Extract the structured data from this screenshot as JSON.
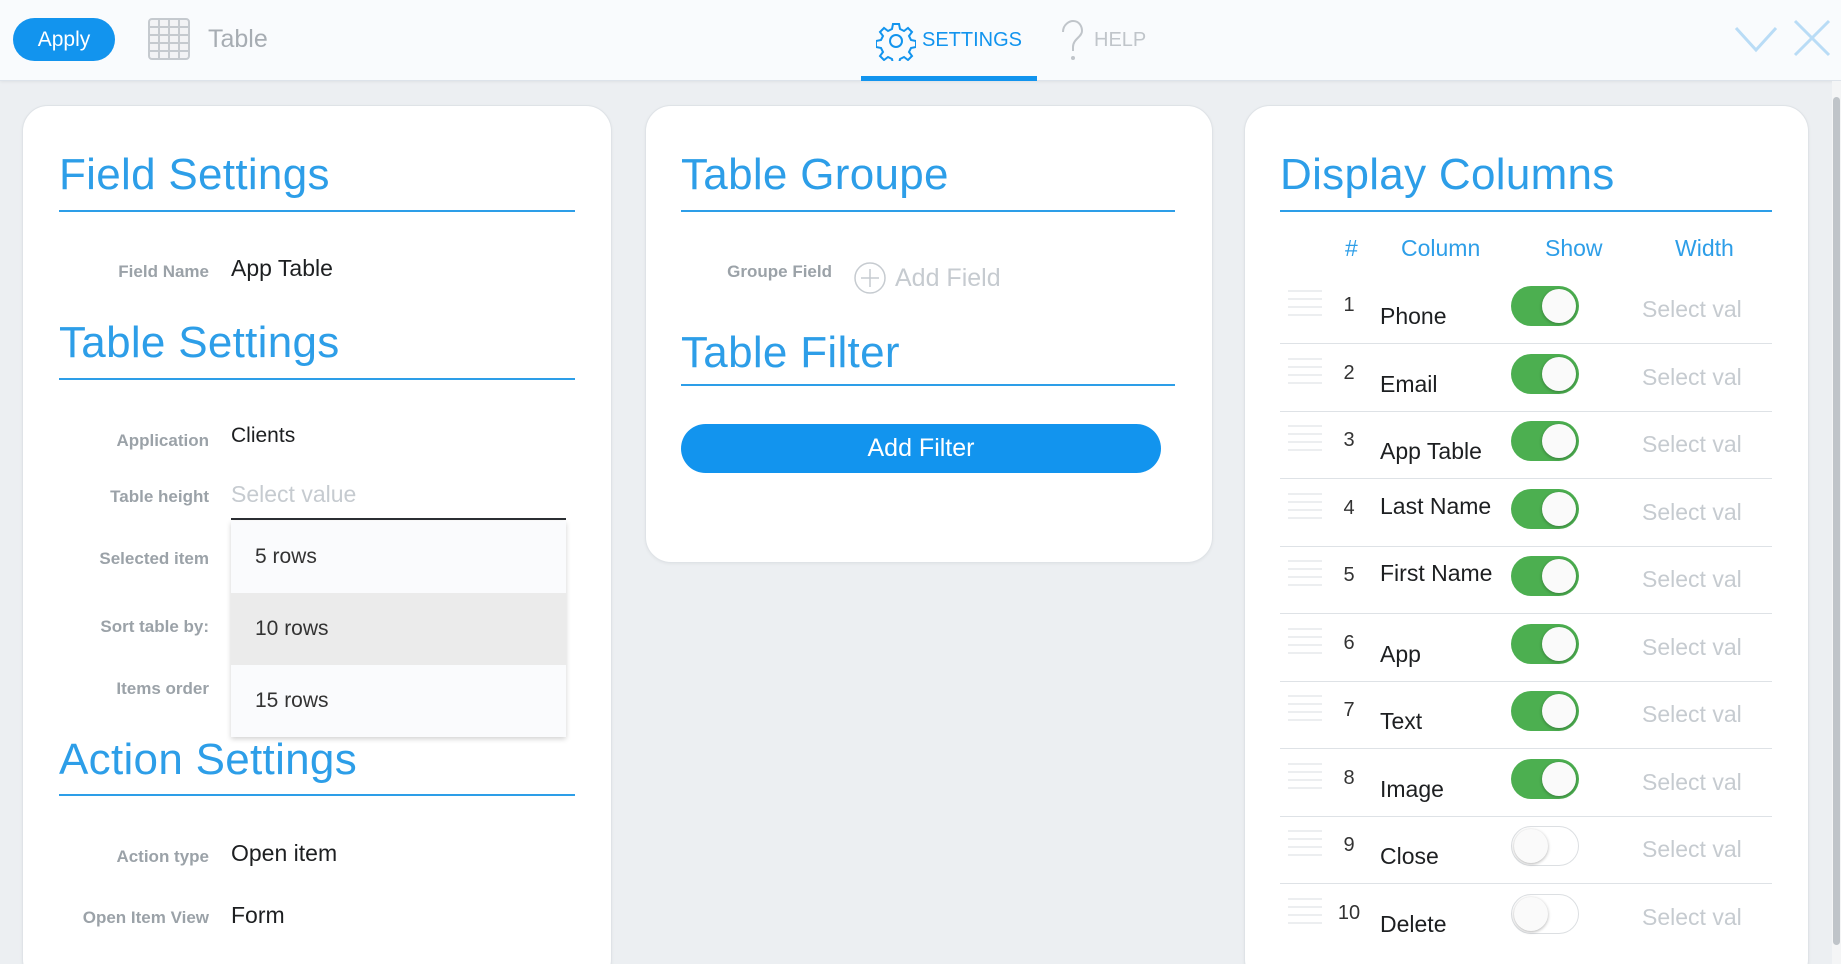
{
  "topbar": {
    "apply_label": "Apply",
    "title": "Table",
    "settings_label": "SETTINGS",
    "help_label": "HELP",
    "accent": "#1294ee"
  },
  "field_settings": {
    "title": "Field Settings",
    "field_name_label": "Field Name",
    "field_name_value": "App Table"
  },
  "table_settings": {
    "title": "Table Settings",
    "application_label": "Application",
    "application_value": "Clients",
    "table_height_label": "Table height",
    "table_height_placeholder": "Select value",
    "selected_item_label": "Selected item",
    "sort_by_label": "Sort table by:",
    "items_order_label": "Items order",
    "dropdown_options": [
      "5 rows",
      "10 rows",
      "15 rows"
    ]
  },
  "action_settings": {
    "title": "Action Settings",
    "action_type_label": "Action type",
    "action_type_value": "Open item",
    "open_item_view_label": "Open Item View",
    "open_item_view_value": "Form"
  },
  "table_groupe": {
    "title": "Table Groupe",
    "groupe_field_label": "Groupe Field",
    "add_field_label": "Add Field"
  },
  "table_filter": {
    "title": "Table Filter",
    "add_filter_label": "Add Filter"
  },
  "display_columns": {
    "title": "Display Columns",
    "headers": {
      "num": "#",
      "column": "Column",
      "show": "Show",
      "width": "Width"
    },
    "width_placeholder": "Select val",
    "rows": [
      {
        "num": "1",
        "name": "Phone",
        "show": true
      },
      {
        "num": "2",
        "name": "Email",
        "show": true
      },
      {
        "num": "3",
        "name": "App Table",
        "show": true
      },
      {
        "num": "4",
        "name": "Last Name",
        "show": true
      },
      {
        "num": "5",
        "name": "First Name",
        "show": true
      },
      {
        "num": "6",
        "name": "App",
        "show": true
      },
      {
        "num": "7",
        "name": "Text",
        "show": true
      },
      {
        "num": "8",
        "name": "Image",
        "show": true
      },
      {
        "num": "9",
        "name": "Close",
        "show": false
      },
      {
        "num": "10",
        "name": "Delete",
        "show": false
      }
    ]
  },
  "icons": {
    "table": "table-grid-icon",
    "settings": "gear-icon",
    "help": "question-mark-icon",
    "collapse": "chevron-down-icon",
    "close": "close-icon",
    "add": "plus-circle-icon",
    "drag": "drag-handle-icon"
  }
}
